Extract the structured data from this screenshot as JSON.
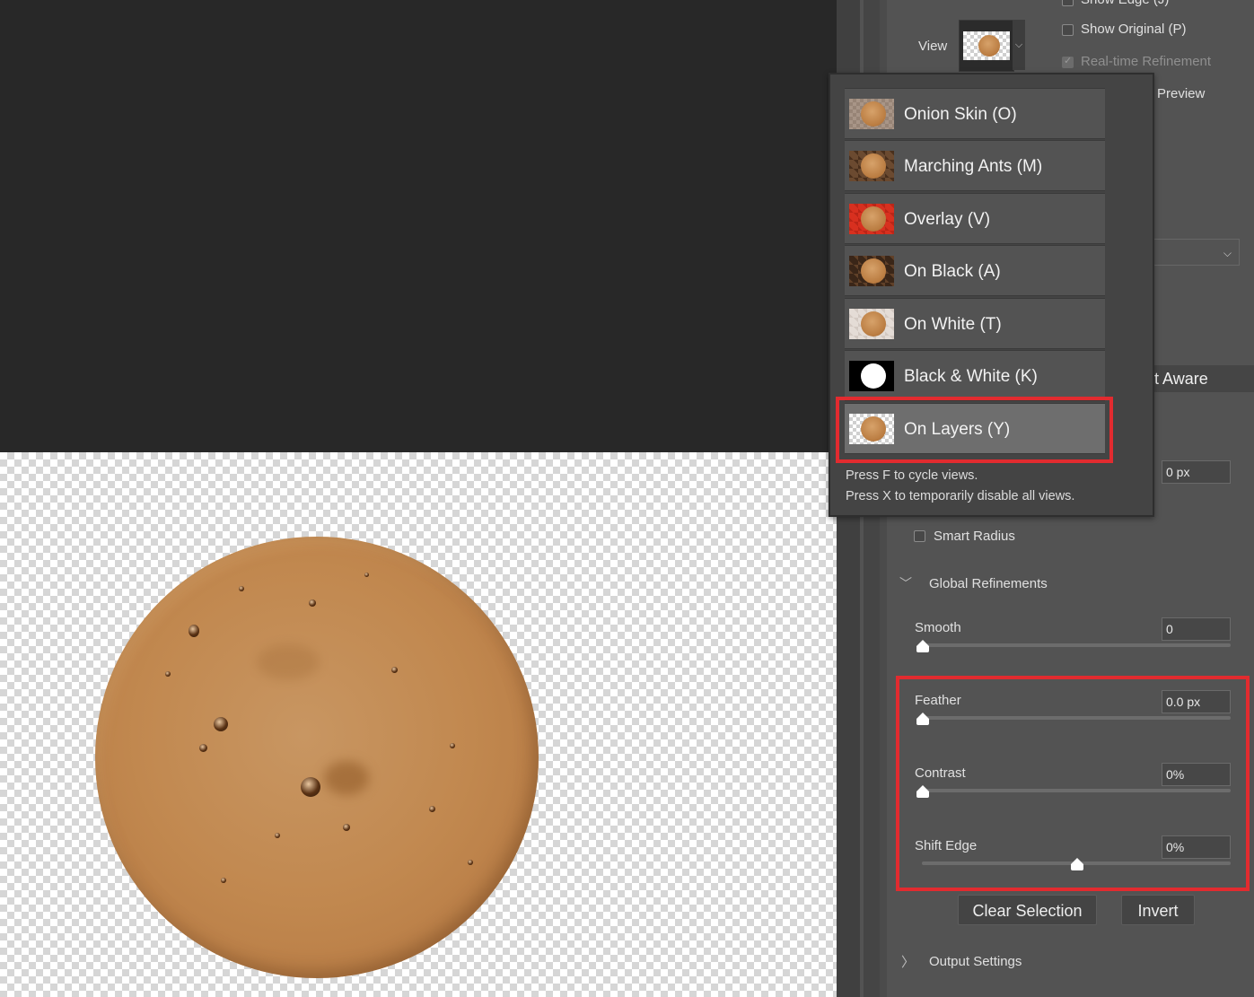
{
  "canvas": {
    "subject": "coffee foam cutout on transparent background"
  },
  "top_options": {
    "show_edge_label": "Show Edge (J)",
    "show_original_label": "Show Original (P)",
    "realtime_refinement_label": "Real-time Refinement",
    "preview_label": "Preview",
    "view_label": "View"
  },
  "view_modes": [
    {
      "label": "Onion Skin (O)",
      "icon": "onion-skin-thumb"
    },
    {
      "label": "Marching Ants (M)",
      "icon": "marching-ants-thumb"
    },
    {
      "label": "Overlay (V)",
      "icon": "overlay-thumb"
    },
    {
      "label": "On Black (A)",
      "icon": "on-black-thumb"
    },
    {
      "label": "On White (T)",
      "icon": "on-white-thumb"
    },
    {
      "label": "Black & White (K)",
      "icon": "black-white-thumb"
    },
    {
      "label": "On Layers (Y)",
      "icon": "on-layers-thumb",
      "selected": true
    }
  ],
  "view_hints": {
    "line1": "Press F to cycle views.",
    "line2": "Press X to temporarily disable all views."
  },
  "edge_detection": {
    "aware_label": "t Aware",
    "radius_value": "0 px",
    "smart_radius_label": "Smart Radius",
    "smart_radius_checked": false
  },
  "global_refinements": {
    "section_label": "Global Refinements",
    "smooth": {
      "label": "Smooth",
      "value": "0"
    },
    "feather": {
      "label": "Feather",
      "value": "0.0 px"
    },
    "contrast": {
      "label": "Contrast",
      "value": "0%"
    },
    "shift_edge": {
      "label": "Shift Edge",
      "value": "0%"
    }
  },
  "buttons": {
    "clear_selection": "Clear Selection",
    "invert": "Invert"
  },
  "output_settings_label": "Output Settings",
  "colors": {
    "highlight": "#e22b2f",
    "panel_bg": "#535353",
    "canvas_bg": "#282828"
  }
}
